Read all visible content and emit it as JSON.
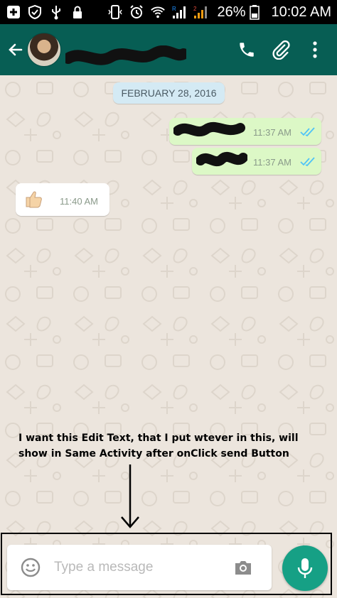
{
  "status_bar": {
    "icons": [
      "plus-box-icon",
      "shield-check-icon",
      "usb-icon",
      "lock-icon",
      "vibrate-icon",
      "alarm-icon",
      "wifi-icon",
      "signal-r-icon",
      "signal-2-icon",
      "battery-icon"
    ],
    "battery_percent": "26%",
    "time": "10:02 AM"
  },
  "app_bar": {
    "contact_name_redacted": true,
    "actions": [
      "phone-icon",
      "attach-icon",
      "overflow-menu-icon"
    ],
    "background": "#075E54"
  },
  "chat": {
    "date_chip": "FEBRUARY 28, 2016",
    "messages": [
      {
        "direction": "outgoing",
        "content_redacted": true,
        "time": "11:37 AM",
        "read_ticks": "double-blue"
      },
      {
        "direction": "outgoing",
        "content_redacted": true,
        "time": "11:37 AM",
        "read_ticks": "double-blue"
      },
      {
        "direction": "incoming",
        "content": "thumbs-up-icon",
        "time": "11:40 AM"
      }
    ]
  },
  "annotation": {
    "text": "I want this Edit Text, that I put wtever in this, will show in Same Activity after onClick send Button"
  },
  "compose": {
    "placeholder": "Type a message",
    "icons": [
      "emoji-icon",
      "camera-icon",
      "mic-icon"
    ],
    "mic_color": "#16A085"
  }
}
